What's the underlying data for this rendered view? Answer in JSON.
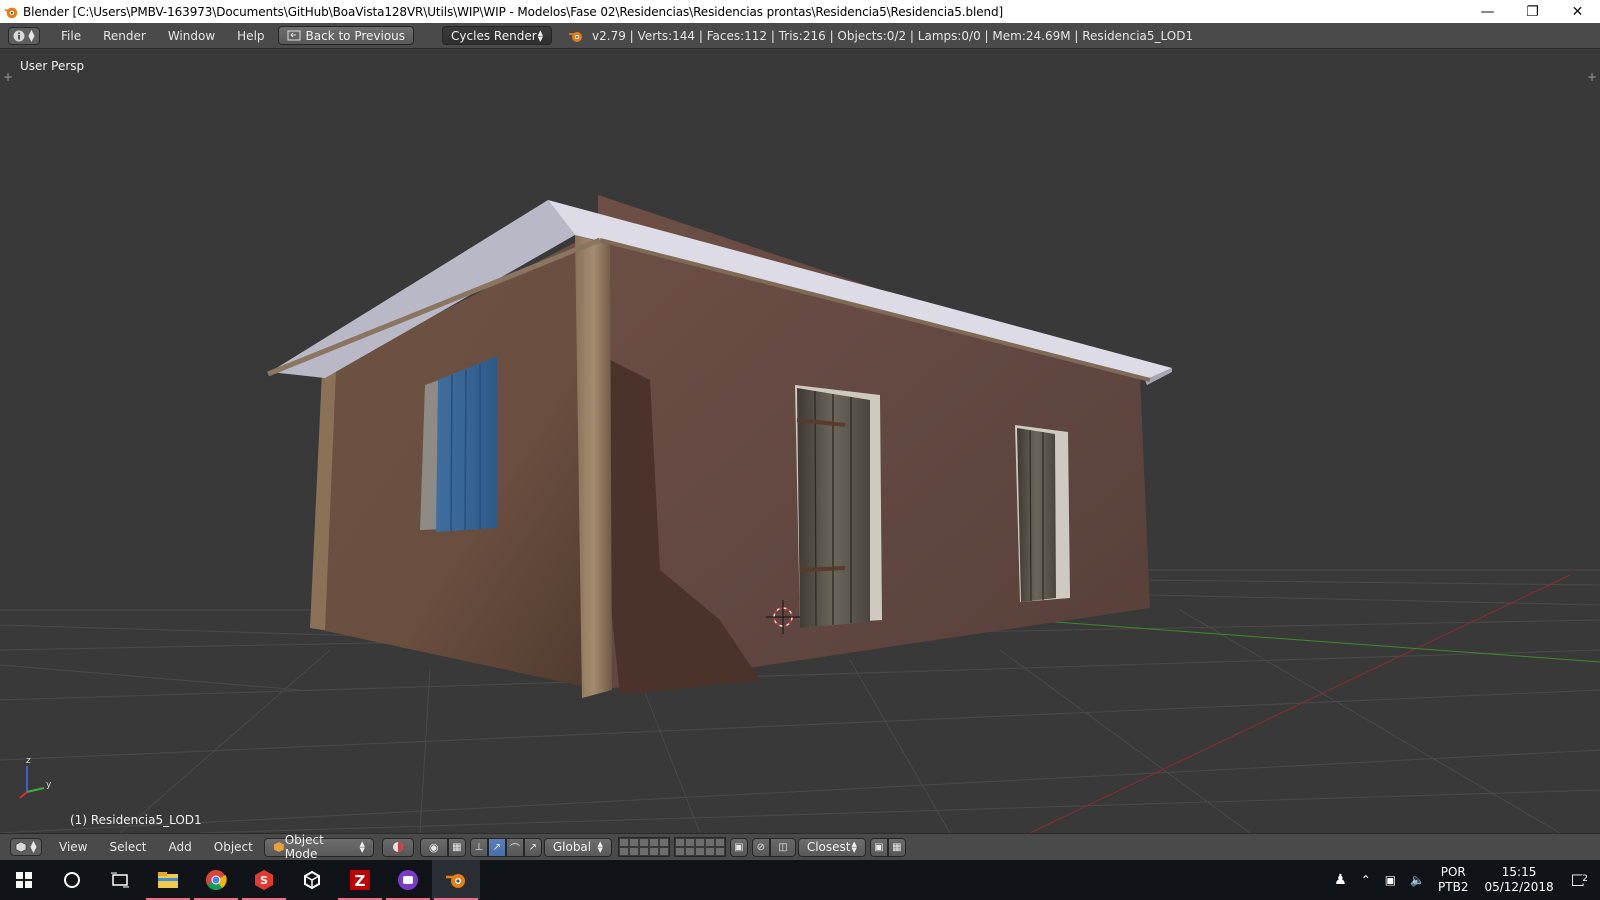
{
  "window": {
    "title": "Blender [C:\\Users\\PMBV-163973\\Documents\\GitHub\\BoaVista128VR\\Utils\\WIP\\WIP - Modelos\\Fase 02\\Residencias\\Residencias prontas\\Residencia5\\Residencia5.blend]",
    "controls": [
      "minimize-icon",
      "restore-icon",
      "close-icon"
    ]
  },
  "info_header": {
    "menus": [
      "File",
      "Render",
      "Window",
      "Help"
    ],
    "back_button": "Back to Previous",
    "render_engine": "Cycles Render",
    "stats": "v2.79 | Verts:144 | Faces:112 | Tris:216 | Objects:0/2 | Lamps:0/0 | Mem:24.69M | Residencia5_LOD1"
  },
  "viewport": {
    "view_name": "User Persp",
    "active_object": "(1) Residencia5_LOD1",
    "axis_labels": {
      "z": "z",
      "y": "y"
    },
    "colors": {
      "background": "#393939",
      "grid": "#4a4a4a",
      "x_axis": "#8a2e2e",
      "y_axis": "#3d8a2e"
    }
  },
  "view3d_header": {
    "menus": [
      "View",
      "Select",
      "Add",
      "Object"
    ],
    "mode": "Object Mode",
    "orientation": "Global",
    "snap_target": "Closest"
  },
  "taskbar": {
    "apps": [
      "windows-start-icon",
      "cortana-icon",
      "task-view-icon",
      "file-explorer-icon",
      "chrome-icon",
      "app-s-icon",
      "unity-icon",
      "filezilla-icon",
      "app-purple-icon",
      "blender-icon"
    ],
    "lang_line1": "POR",
    "lang_line2": "PTB2",
    "time": "15:15",
    "date": "05/12/2018",
    "notifications": "2"
  }
}
